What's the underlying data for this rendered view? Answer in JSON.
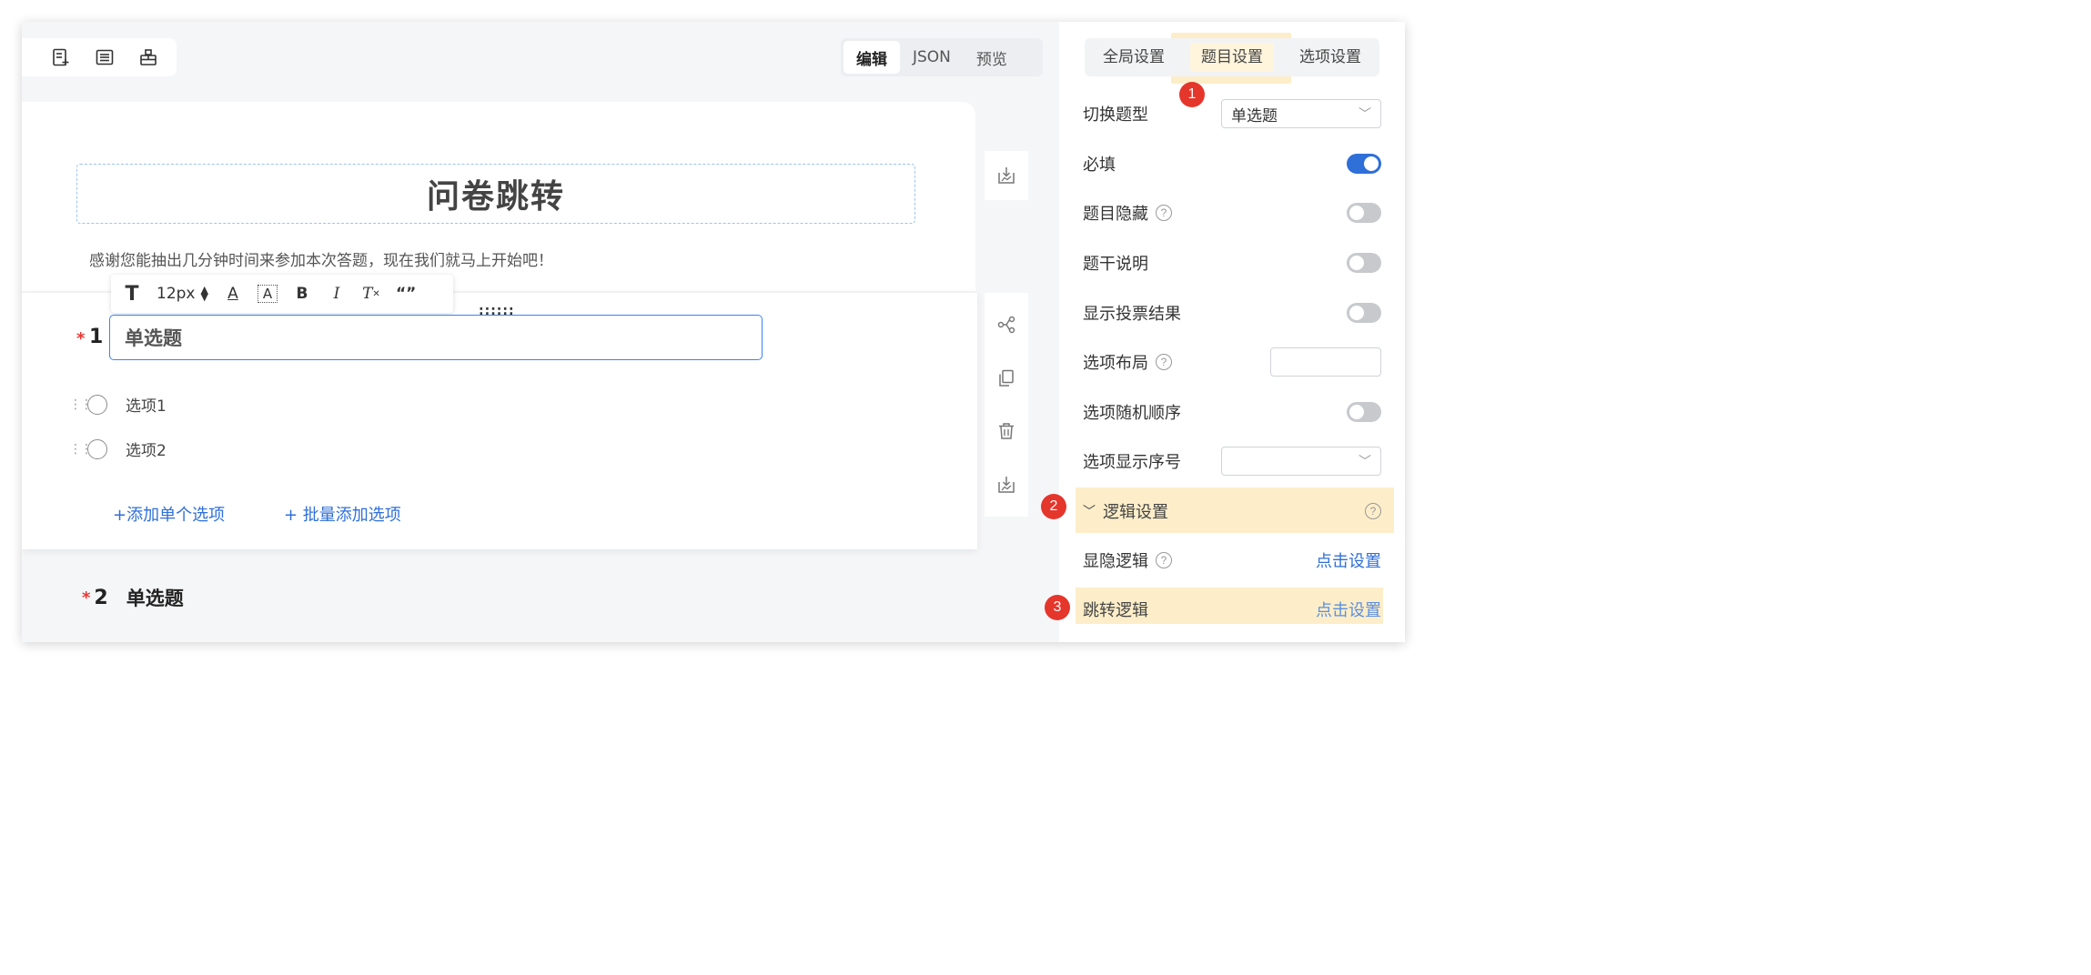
{
  "toolbar_icons": [
    "add-question-icon",
    "keyboard-icon",
    "structure-icon"
  ],
  "mode_switch": {
    "edit": "编辑",
    "json": "JSON",
    "preview": "预览",
    "active": "编辑"
  },
  "survey": {
    "title": "问卷跳转",
    "description": "感谢您能抽出几分钟时间来参加本次答题，现在我们就马上开始吧！"
  },
  "format_toolbar": {
    "font_size": "12px",
    "drag_handle": "::::::"
  },
  "question1": {
    "required_mark": "*",
    "number": "1",
    "title": "单选题",
    "options": [
      "选项1",
      "选项2"
    ],
    "add_single": "+添加单个选项",
    "add_batch": "+ 批量添加选项"
  },
  "question2": {
    "required_mark": "*",
    "number": "2",
    "title": "单选题"
  },
  "panel": {
    "tabs": [
      "全局设置",
      "题目设置",
      "选项设置"
    ],
    "active_tab": "题目设置",
    "rows": {
      "switch_type_label": "切换题型",
      "switch_type_value": "单选题",
      "required_label": "必填",
      "hide_label": "题目隐藏",
      "stem_desc_label": "题干说明",
      "vote_result_label": "显示投票结果",
      "layout_label": "选项布局",
      "random_label": "选项随机顺序",
      "show_index_label": "选项显示序号",
      "logic_section": "逻辑设置",
      "visibility_logic_label": "显隐逻辑",
      "visibility_logic_link": "点击设置",
      "jump_logic_label": "跳转逻辑",
      "jump_logic_link": "点击设置"
    },
    "toggles": {
      "required": true,
      "hide": false,
      "stem_desc": false,
      "vote_result": false,
      "random": false
    }
  },
  "badges": [
    "1",
    "2",
    "3"
  ],
  "colors": {
    "accent": "#2f6fd8",
    "highlight": "#fdeec9",
    "badge": "#e5362c",
    "required": "#e53935"
  }
}
